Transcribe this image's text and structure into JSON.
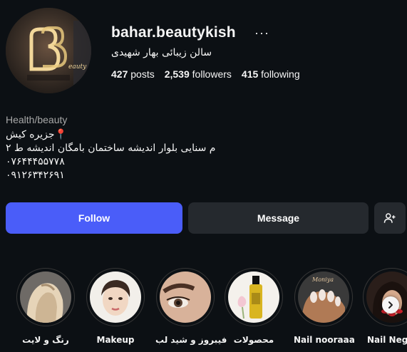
{
  "profile": {
    "username": "bahar.beautykish",
    "more_icon": "more-horizontal-icon",
    "full_name": "سالن زیبائی بهار شهیدی",
    "avatar_text": "eauty Center"
  },
  "stats": {
    "posts_count": "427",
    "posts_label": "posts",
    "followers_count": "2,539",
    "followers_label": "followers",
    "following_count": "415",
    "following_label": "following"
  },
  "bio": {
    "category": "Health/beauty",
    "line1": "📍جزیره کیش",
    "line2": "م سنایی بلوار اندیشه ساختمان بامگان اندیشه ط ۲",
    "line3": "۰۷۶۴۴۴۵۵۷۷۸",
    "line4": "۰۹۱۲۶۳۴۲۶۹۱"
  },
  "actions": {
    "follow_label": "Follow",
    "message_label": "Message",
    "add_user_icon": "add-user-icon"
  },
  "highlights": [
    {
      "label": "رنگ و لایت"
    },
    {
      "label": "Makeup"
    },
    {
      "label": "فیبروز و شید لب"
    },
    {
      "label": "محصولات"
    },
    {
      "label": "Nail nooraaa"
    },
    {
      "label": "Nail Negin"
    }
  ],
  "colors": {
    "background": "#0c1014",
    "follow_button": "#4a5df9",
    "secondary_button": "#25292e",
    "muted_text": "#a8a8a8"
  }
}
